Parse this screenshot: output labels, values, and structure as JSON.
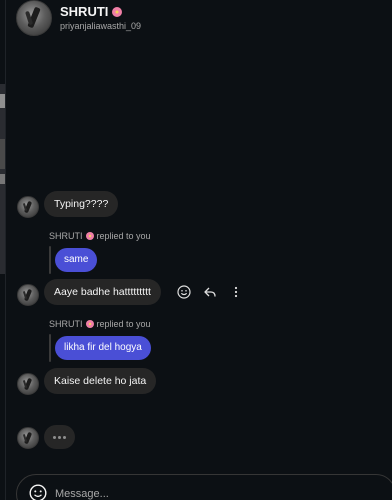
{
  "header": {
    "name": "SHRUTI",
    "username": "priyanjaliawasthi_09"
  },
  "messages": [
    {
      "text": "Typing????"
    },
    {
      "reply_label": "SHRUTI",
      "reply_suffix": "replied to you",
      "reply_text": "same"
    },
    {
      "text": "Aaye badhe hattttttttt"
    },
    {
      "reply_label": "SHRUTI",
      "reply_suffix": "replied to you",
      "reply_text": "likha fir del hogya"
    },
    {
      "text": "Kaise delete ho jata"
    }
  ],
  "typing_indicator": "•••",
  "composer": {
    "placeholder": "Message..."
  },
  "colors": {
    "background": "#0c1014",
    "bubble_incoming": "#262626",
    "reply_bubble": "#4a4fd6"
  }
}
